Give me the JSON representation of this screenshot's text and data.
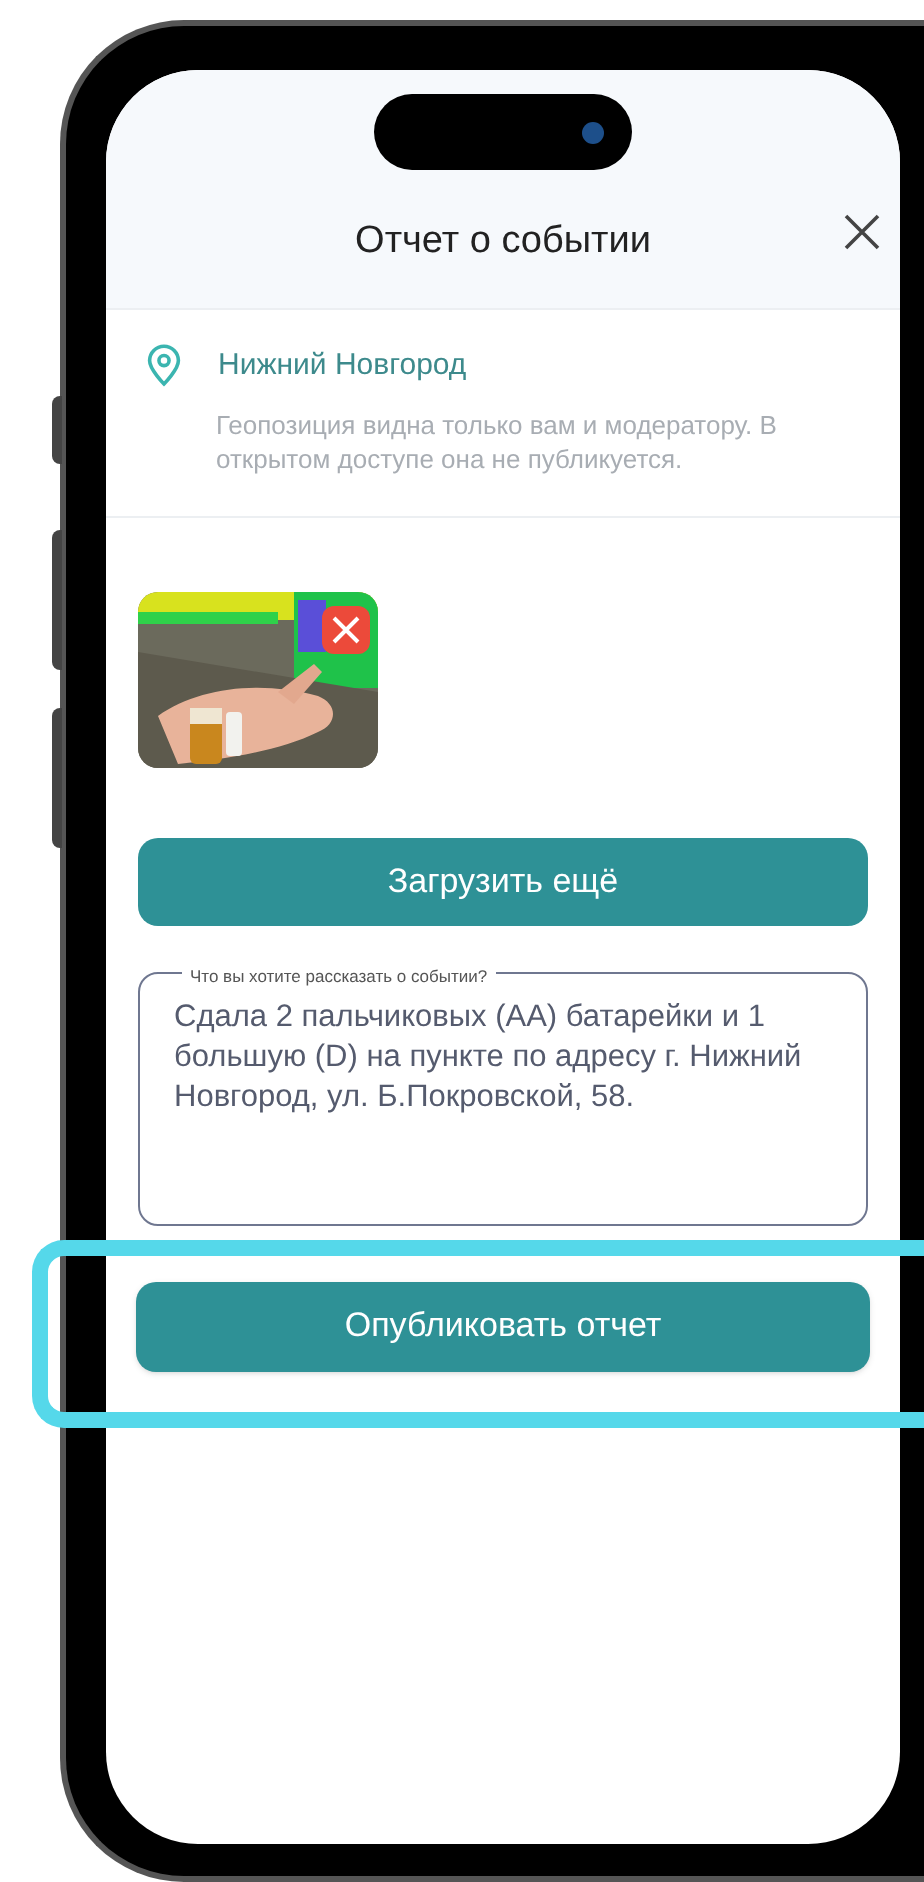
{
  "header": {
    "title": "Отчет о событии"
  },
  "location": {
    "name": "Нижний Новгород",
    "hint": "Геопозиция видна только вам и модератору. В открытом доступе она не публикуется."
  },
  "upload_button": {
    "label": "Загрузить ещё"
  },
  "description": {
    "label": "Что вы хотите рассказать о событии?",
    "value": "Сдала 2 пальчиковых (АА) батарейки и 1 большую (D) на пункте по адресу г. Нижний Новгород, ул. Б.Покровской, 58."
  },
  "publish_button": {
    "label": "Опубликовать отчет",
    "highlighted": true
  }
}
